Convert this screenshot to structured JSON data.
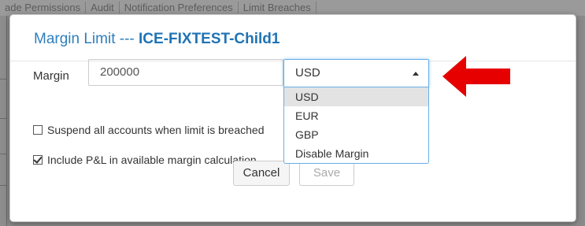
{
  "background": {
    "tabs": [
      "ade Permissions",
      "Audit",
      "Notification Preferences",
      "Limit Breaches"
    ]
  },
  "modal": {
    "title": "Margin Limit --- ",
    "subtitle": "ICE-FIXTEST-Child1",
    "margin_label": "Margin",
    "margin_value": "200000",
    "currency_selected": "USD",
    "currency_options": [
      "USD",
      "EUR",
      "GBP",
      "Disable Margin"
    ],
    "suspend_label": "Suspend all accounts when limit is breached",
    "suspend_checked": false,
    "include_pl_label": "Include P&L in available margin calculation",
    "include_pl_checked": true,
    "cancel_label": "Cancel",
    "save_label": "Save"
  },
  "annotation": {
    "arrow_color": "#e60000",
    "arrow_icon": "red-arrow-left-icon"
  }
}
